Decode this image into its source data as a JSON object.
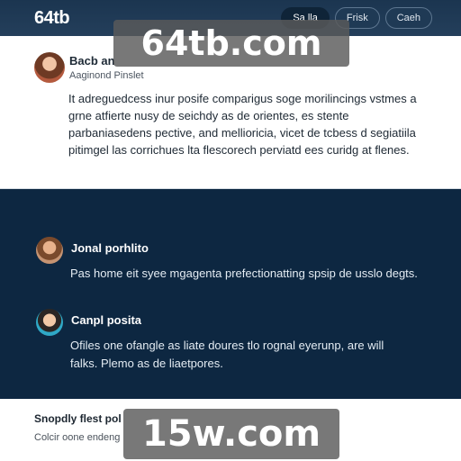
{
  "header": {
    "logo": "64tb",
    "nav": [
      "Sa lla",
      "Frisk",
      "Caeh"
    ]
  },
  "post": {
    "author": "Bacb an",
    "subtitle": "Aaginond Pinslet",
    "body": "It adreguedcess inur posife comparigus soge morilincings vstmes a grne atfierte nusy de seichdy as de orientes, es stente parbaniasedens pective, and mellioricia, vicet de tcbess d segiatiila pitimgel las corrichues lta flescorech perviatd ees curidg at flenes."
  },
  "items": [
    {
      "name": "Jonal porhlito",
      "text": "Pas home eit syee mgagenta prefectionatting spsip de usslo degts."
    },
    {
      "name": "Canpl posita",
      "text": "Ofiles one ofangle as liate doures tlo rognal eyerunp, are will falks. Plemo as de liaetpores."
    }
  ],
  "bottom": {
    "title": "Snopdly flest pol",
    "text": "Colcir oone endeng"
  },
  "watermarks": [
    "64tb.com",
    "15w.com"
  ],
  "colors": {
    "header": "#1b3550",
    "dark_section": "#0d2741",
    "accent": "#0f2438"
  }
}
